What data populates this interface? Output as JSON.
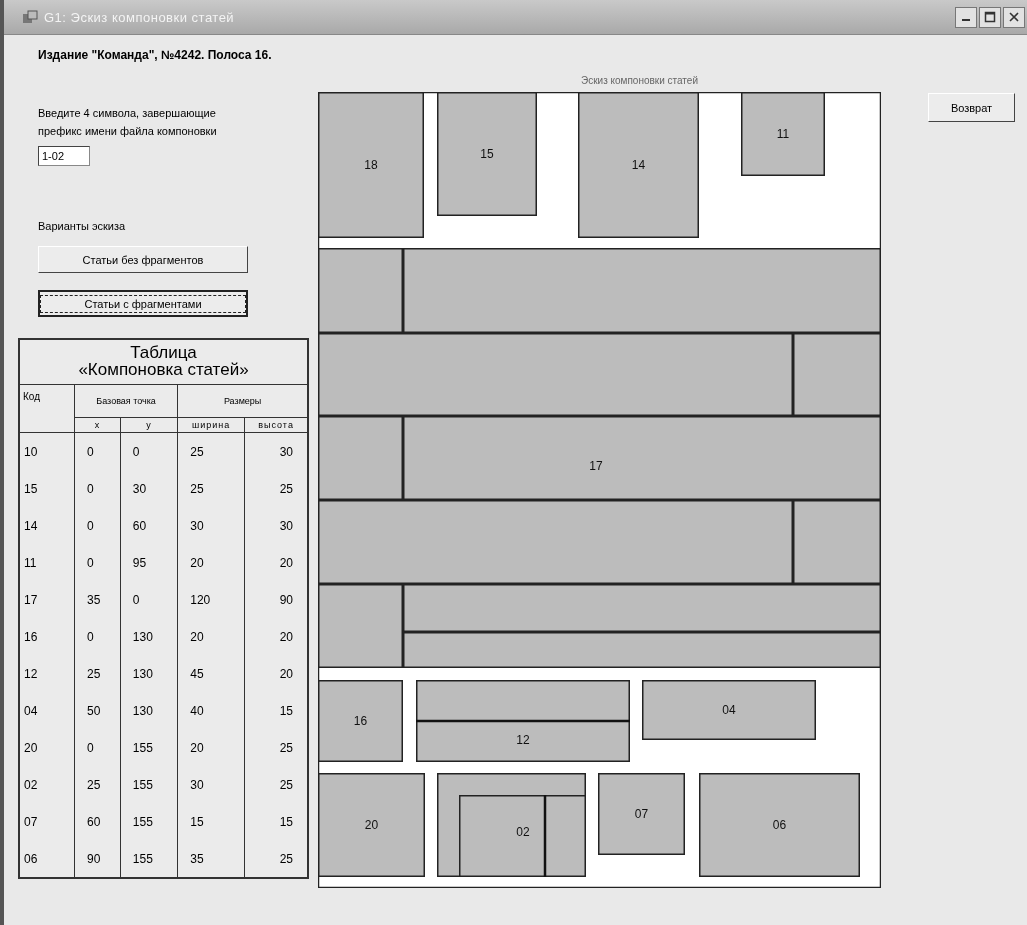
{
  "window": {
    "title": "G1: Эскиз компоновки статей"
  },
  "header": "Издание \"Команда\", №4242. Полоса 16.",
  "prompt": "Введите 4 символа, завершающие префикс имени файла компоновки",
  "prefix_field": {
    "value": "1-02"
  },
  "variants_label": "Варианты эскиза",
  "variant_buttons": [
    {
      "label": "Статьи без фрагментов",
      "focused": false
    },
    {
      "label": "Статьи с фрагментами",
      "focused": true
    }
  ],
  "table": {
    "title": [
      "Таблица",
      "«Компоновка статей»"
    ],
    "code_header": "Код",
    "point_header": "Базовая точка",
    "size_header": "Размеры",
    "subheaders": [
      "x",
      "y",
      "ширина",
      "высота"
    ],
    "rows": [
      [
        "10",
        "0",
        "0",
        "25",
        "30"
      ],
      [
        "15",
        "0",
        "30",
        "25",
        "25"
      ],
      [
        "14",
        "0",
        "60",
        "30",
        "30"
      ],
      [
        "11",
        "0",
        "95",
        "20",
        "20"
      ],
      [
        "17",
        "35",
        "0",
        "120",
        "90"
      ],
      [
        "16",
        "0",
        "130",
        "20",
        "20"
      ],
      [
        "12",
        "25",
        "130",
        "45",
        "20"
      ],
      [
        "04",
        "50",
        "130",
        "40",
        "15"
      ],
      [
        "20",
        "0",
        "155",
        "20",
        "25"
      ],
      [
        "02",
        "25",
        "155",
        "30",
        "25"
      ],
      [
        "07",
        "60",
        "155",
        "15",
        "15"
      ],
      [
        "06",
        "90",
        "155",
        "35",
        "25"
      ]
    ]
  },
  "sketch": {
    "caption": "Эскиз компоновки статей",
    "blocks": [
      {
        "label": "18"
      },
      {
        "label": "15"
      },
      {
        "label": "14"
      },
      {
        "label": "11"
      },
      {
        "label": "17"
      },
      {
        "label": "16"
      },
      {
        "label": "12"
      },
      {
        "label": "04"
      },
      {
        "label": "20"
      },
      {
        "label": "02"
      },
      {
        "label": "07"
      },
      {
        "label": "06"
      }
    ]
  },
  "return_button": "Возврат"
}
